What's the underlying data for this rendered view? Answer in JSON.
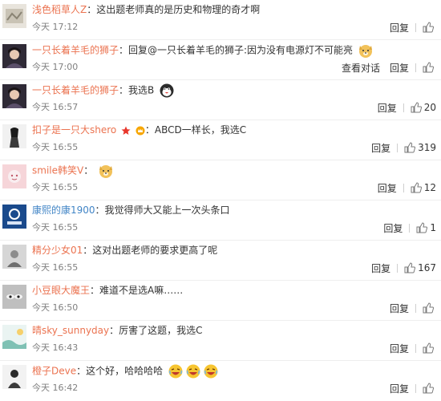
{
  "comments": [
    {
      "user": "浅色稻草人Z",
      "text": "：这出题老师真的是历史和物理的奇才啊",
      "time": "今天 17:12",
      "actions": [
        "回复"
      ],
      "likes": "",
      "emoji": []
    },
    {
      "user": "一只长着羊毛的狮子",
      "text": "：回复@一只长着羊毛的狮子:因为没有电源灯不可能亮",
      "time": "今天 17:00",
      "actions": [
        "查看对话",
        "回复"
      ],
      "likes": "",
      "emoji": [
        "dog-emoji"
      ]
    },
    {
      "user": "一只长着羊毛的狮子",
      "text": "：我选B",
      "time": "今天 16:57",
      "actions": [
        "回复"
      ],
      "likes": "20",
      "emoji": [
        "penguin-emoji"
      ]
    },
    {
      "user": "扣子是一只大shero",
      "text": "：ABCD一样长，我选C",
      "time": "今天 16:55",
      "actions": [
        "回复"
      ],
      "likes": "319",
      "emoji": []
    },
    {
      "user": "smile韩笑V",
      "text": "：",
      "time": "今天 16:55",
      "actions": [
        "回复"
      ],
      "likes": "12",
      "emoji": [
        "dog-emoji"
      ]
    },
    {
      "user": "康熙的康1900",
      "text": "：我觉得师大又能上一次头条口",
      "time": "今天 16:55",
      "actions": [
        "回复"
      ],
      "likes": "1",
      "emoji": []
    },
    {
      "user": "精分少女01",
      "text": "：这对出题老师的要求更高了呢",
      "time": "今天 16:55",
      "actions": [
        "回复"
      ],
      "likes": "167",
      "emoji": []
    },
    {
      "user": "小豆眼大魔王",
      "text": "：难道不是选A嘛……",
      "time": "今天 16:50",
      "actions": [
        "回复"
      ],
      "likes": "",
      "emoji": []
    },
    {
      "user": "晴sky_sunnyday",
      "text": "：厉害了这题，我选C",
      "time": "今天 16:43",
      "actions": [
        "回复"
      ],
      "likes": "",
      "emoji": []
    },
    {
      "user": "橙子Deve",
      "text": "：这个好，哈哈哈哈",
      "time": "今天 16:42",
      "actions": [
        "回复"
      ],
      "likes": "",
      "emoji": [
        "laughing-emoji",
        "laughing-emoji",
        "laughing-emoji"
      ]
    }
  ],
  "colors": {
    "username": "#eb7350",
    "link": "#4285c6",
    "text": "#333333",
    "time": "#808080"
  }
}
